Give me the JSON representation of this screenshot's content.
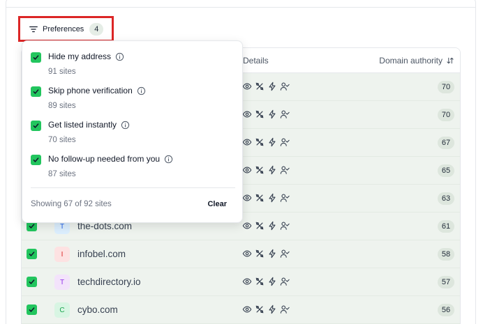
{
  "toolbar": {
    "preferences_label": "Preferences",
    "preferences_count": "4"
  },
  "table": {
    "col_details": "Details",
    "col_domain_authority": "Domain authority",
    "rows": [
      {
        "initial": "",
        "domain": "",
        "da": "70",
        "avatar_bg": "#eef3ee",
        "avatar_fg": "#374151"
      },
      {
        "initial": "",
        "domain": "",
        "da": "70",
        "avatar_bg": "#eef3ee",
        "avatar_fg": "#374151"
      },
      {
        "initial": "",
        "domain": "",
        "da": "67",
        "avatar_bg": "#eef3ee",
        "avatar_fg": "#374151"
      },
      {
        "initial": "",
        "domain": "",
        "da": "65",
        "avatar_bg": "#eef3ee",
        "avatar_fg": "#374151"
      },
      {
        "initial": "",
        "domain": "",
        "da": "63",
        "avatar_bg": "#eef3ee",
        "avatar_fg": "#374151"
      },
      {
        "initial": "T",
        "domain": "the-dots.com",
        "da": "61",
        "avatar_bg": "#dbeefe",
        "avatar_fg": "#2563eb"
      },
      {
        "initial": "I",
        "domain": "infobel.com",
        "da": "58",
        "avatar_bg": "#fde2e2",
        "avatar_fg": "#dc2626"
      },
      {
        "initial": "T",
        "domain": "techdirectory.io",
        "da": "57",
        "avatar_bg": "#f3e3fb",
        "avatar_fg": "#9333ea"
      },
      {
        "initial": "C",
        "domain": "cybo.com",
        "da": "56",
        "avatar_bg": "#d8f5e3",
        "avatar_fg": "#16a34a"
      }
    ]
  },
  "popover": {
    "options": [
      {
        "label": "Hide my address",
        "count": "91 sites"
      },
      {
        "label": "Skip phone verification",
        "count": "89 sites"
      },
      {
        "label": "Get listed instantly",
        "count": "70 sites"
      },
      {
        "label": "No follow-up needed from you",
        "count": "87 sites"
      }
    ],
    "showing_text": "Showing 67 of 92 sites",
    "clear_label": "Clear"
  },
  "colors": {
    "accent_green": "#22c55e",
    "highlight_red": "#dc2626",
    "row_bg": "#eef3ee"
  },
  "icons": [
    "filter-icon",
    "sort-icon",
    "eye-icon",
    "percent-icon",
    "bolt-icon",
    "user-check-icon",
    "info-icon",
    "check-icon"
  ]
}
